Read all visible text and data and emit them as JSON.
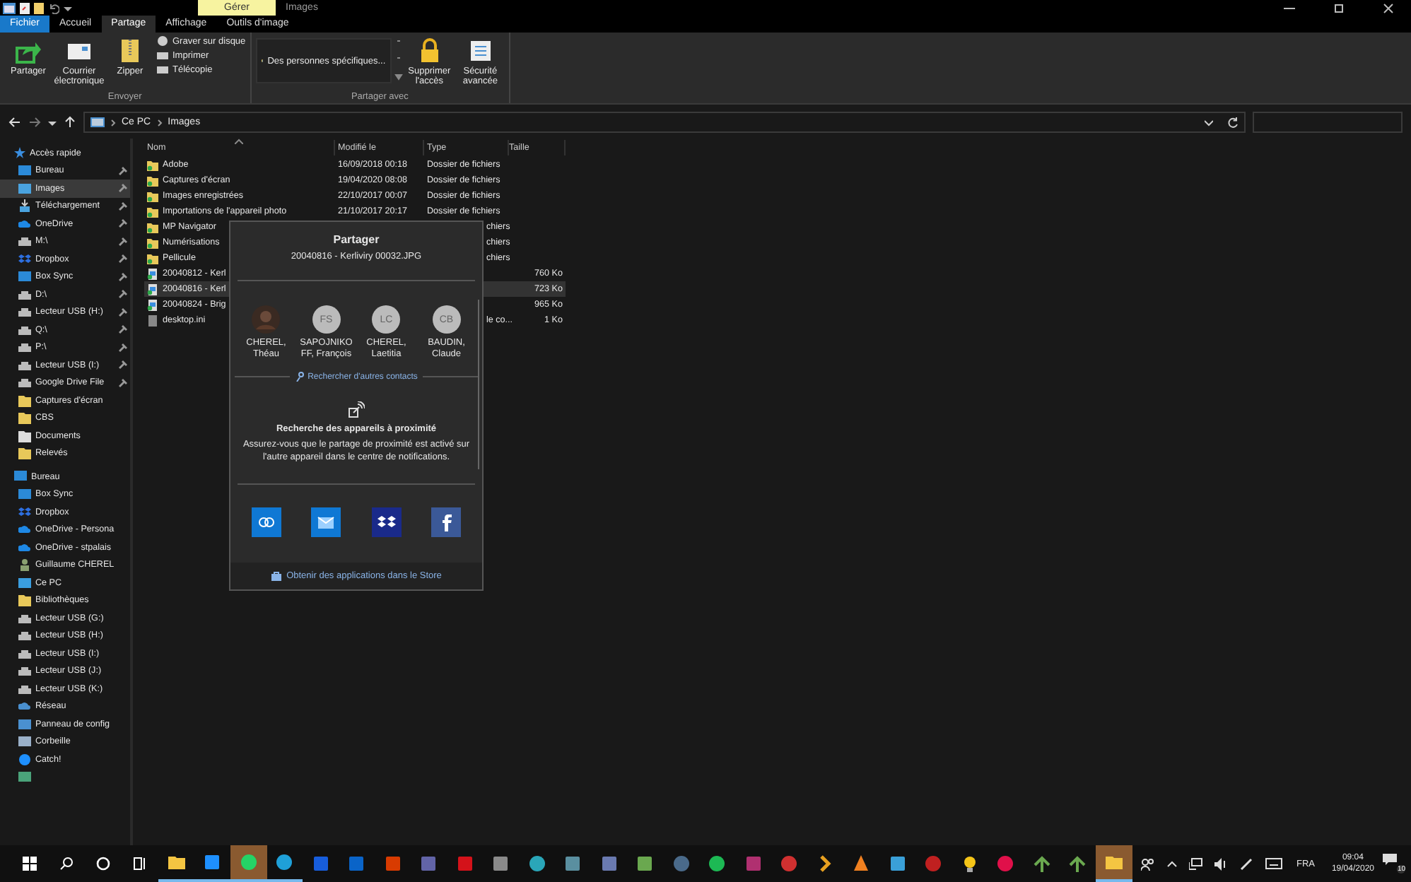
{
  "title_bar": {
    "context_tab": "Gérer",
    "title": "Images"
  },
  "ribbon_tabs": [
    {
      "label": "Fichier",
      "kind": "file",
      "selected": false
    },
    {
      "label": "Accueil",
      "kind": "tab",
      "selected": false
    },
    {
      "label": "Partage",
      "kind": "tab",
      "selected": true
    },
    {
      "label": "Affichage",
      "kind": "tab",
      "selected": false
    },
    {
      "label": "Outils d'image",
      "kind": "tab",
      "selected": false
    }
  ],
  "ribbon_groups": [
    {
      "label": "Envoyer",
      "large": [
        {
          "label": "Partager",
          "kind": "share"
        },
        {
          "label": "Courrier électronique",
          "kind": "mail"
        },
        {
          "label": "Zipper",
          "kind": "zip"
        }
      ],
      "small": [
        "Graver sur disque",
        "Imprimer",
        "Télécopie"
      ]
    },
    {
      "label": "Partager avec",
      "gallery": "Des personnes spécifiques...",
      "large": [
        {
          "label": "Supprimer l'accès",
          "kind": "lock"
        },
        {
          "label": "Sécurité avancée",
          "kind": "security"
        }
      ]
    }
  ],
  "address_bar": {
    "path": [
      "Ce PC",
      "Images"
    ]
  },
  "sidebar": {
    "sections": [
      {
        "label": "Accès rapide",
        "kind": "star",
        "items": [
          {
            "label": "Bureau",
            "kind": "tile",
            "color": "#2b8ad8",
            "pinned": true,
            "selected": false
          },
          {
            "label": "Images",
            "kind": "tile",
            "color": "#4aa3df",
            "pinned": true,
            "selected": true
          },
          {
            "label": "Téléchargement",
            "kind": "download",
            "color": "#4aa3df",
            "pinned": true,
            "selected": false
          },
          {
            "label": "OneDrive",
            "kind": "cloud",
            "color": "#1e88e5",
            "pinned": true,
            "selected": false
          },
          {
            "label": "M:\\",
            "kind": "drive",
            "color": "#bbbbbb",
            "pinned": true,
            "selected": false
          },
          {
            "label": "Dropbox",
            "kind": "dropbox",
            "color": "#2d6fe0",
            "pinned": true,
            "selected": false
          },
          {
            "label": "Box Sync",
            "kind": "tile",
            "color": "#2b8ad8",
            "pinned": true,
            "selected": false
          },
          {
            "label": "D:\\",
            "kind": "drive",
            "color": "#bbbbbb",
            "pinned": true,
            "selected": false
          },
          {
            "label": "Lecteur USB (H:)",
            "kind": "drive",
            "color": "#bbbbbb",
            "pinned": true,
            "selected": false
          },
          {
            "label": "Q:\\",
            "kind": "drive",
            "color": "#bbbbbb",
            "pinned": true,
            "selected": false
          },
          {
            "label": "P:\\",
            "kind": "drive",
            "color": "#bbbbbb",
            "pinned": true,
            "selected": false
          },
          {
            "label": "Lecteur USB (I:)",
            "kind": "drive",
            "color": "#bbbbbb",
            "pinned": true,
            "selected": false
          },
          {
            "label": "Google Drive File",
            "kind": "drive",
            "color": "#bbbbbb",
            "pinned": true,
            "selected": false
          },
          {
            "label": "Captures d'écran",
            "kind": "folder",
            "color": "#e8c85a",
            "pinned": false,
            "selected": false
          },
          {
            "label": "CBS",
            "kind": "folder",
            "color": "#e8c85a",
            "pinned": false,
            "selected": false
          },
          {
            "label": "Documents",
            "kind": "folder",
            "color": "#dddddd",
            "pinned": false,
            "selected": false
          },
          {
            "label": "Relevés",
            "kind": "folder",
            "color": "#e8c85a",
            "pinned": false,
            "selected": false
          }
        ]
      },
      {
        "label": "Bureau",
        "kind": "tile",
        "items": [
          {
            "label": "Box Sync",
            "kind": "tile",
            "color": "#2b8ad8",
            "selected": false
          },
          {
            "label": "Dropbox",
            "kind": "dropbox",
            "color": "#2d6fe0",
            "selected": false
          },
          {
            "label": "OneDrive - Persona",
            "kind": "cloud",
            "color": "#1e88e5",
            "selected": false
          },
          {
            "label": "OneDrive - stpalais",
            "kind": "cloud",
            "color": "#1e88e5",
            "selected": false
          },
          {
            "label": "Guillaume CHEREL",
            "kind": "person",
            "color": "#8aa070",
            "selected": false
          },
          {
            "label": "Ce PC",
            "kind": "tile",
            "color": "#3a9ee0",
            "selected": false
          },
          {
            "label": "Bibliothèques",
            "kind": "folder",
            "color": "#e8c85a",
            "selected": false
          },
          {
            "label": "Lecteur USB (G:)",
            "kind": "drive",
            "color": "#bbbbbb",
            "selected": false
          },
          {
            "label": "Lecteur USB (H:)",
            "kind": "drive",
            "color": "#bbbbbb",
            "selected": false
          },
          {
            "label": "Lecteur USB (I:)",
            "kind": "drive",
            "color": "#bbbbbb",
            "selected": false
          },
          {
            "label": "Lecteur USB (J:)",
            "kind": "drive",
            "color": "#bbbbbb",
            "selected": false
          },
          {
            "label": "Lecteur USB (K:)",
            "kind": "drive",
            "color": "#bbbbbb",
            "selected": false
          },
          {
            "label": "Réseau",
            "kind": "cloud",
            "color": "#4a90d0",
            "selected": false
          },
          {
            "label": "Panneau de config",
            "kind": "tile",
            "color": "#4a90d0",
            "selected": false
          },
          {
            "label": "Corbeille",
            "kind": "tile",
            "color": "#9ab0c8",
            "selected": false
          },
          {
            "label": "Catch!",
            "kind": "circle",
            "color": "#1e90ff",
            "selected": false
          },
          {
            "kind": "tile",
            "color": "#4aa37a",
            "selected": false
          }
        ]
      }
    ]
  },
  "file_list": {
    "columns": [
      "Nom",
      "Modifié le",
      "Type",
      "Taille"
    ],
    "rows": [
      {
        "kind": "folder",
        "name": "Adobe",
        "modified": "16/09/2018 00:18",
        "type": "Dossier de fichiers",
        "selected": false
      },
      {
        "kind": "folder",
        "name": "Captures d'écran",
        "modified": "19/04/2020 08:08",
        "type": "Dossier de fichiers",
        "selected": false
      },
      {
        "kind": "folder",
        "name": "Images enregistrées",
        "modified": "22/10/2017 00:07",
        "type": "Dossier de fichiers",
        "selected": false
      },
      {
        "kind": "folder",
        "name": "Importations de l'appareil photo",
        "modified": "21/10/2017 20:17",
        "type": "Dossier de fichiers",
        "selected": false
      },
      {
        "kind": "folder",
        "name": "MP Navigator",
        "type": "chiers",
        "selected": false
      },
      {
        "kind": "folder",
        "name": "Numérisations",
        "type": "chiers",
        "selected": false
      },
      {
        "kind": "folder",
        "name": "Pellicule",
        "type": "chiers",
        "selected": false
      },
      {
        "kind": "image",
        "name": "20040812 - Kerl",
        "size": "760 Ko",
        "selected": false
      },
      {
        "kind": "image",
        "name": "20040816 - Kerl",
        "size": "723 Ko",
        "selected": true
      },
      {
        "kind": "image",
        "name": "20040824 - Brig",
        "size": "965 Ko",
        "selected": false
      },
      {
        "kind": "file",
        "name": "desktop.ini",
        "type": "le co...",
        "size": "1 Ko",
        "selected": false
      }
    ]
  },
  "share_dialog": {
    "title": "Partager",
    "file": "20040816 - Kerliviry 00032.JPG",
    "contacts": [
      {
        "kind": "photo",
        "name": "CHEREL, Théau"
      },
      {
        "kind": "initials",
        "initials": "FS",
        "name": "SAPOJNIKO FF, François"
      },
      {
        "kind": "initials",
        "initials": "LC",
        "name": "CHEREL, Laetitia"
      },
      {
        "kind": "initials",
        "initials": "CB",
        "name": "BAUDIN, Claude"
      }
    ],
    "find_contacts": "Rechercher d'autres contacts",
    "nearby_title": "Recherche des appareils à proximité",
    "nearby_text": "Assurez-vous que le partage de proximité est activé sur l'autre appareil dans le centre de notifications.",
    "apps": [
      {
        "kind": "link",
        "color": "#0f78d4"
      },
      {
        "kind": "mail",
        "color": "#0f78d4"
      },
      {
        "kind": "dropbox",
        "color": "#1a2a8a"
      },
      {
        "kind": "facebook",
        "color": "#3b5998"
      }
    ],
    "store_link": "Obtenir des applications dans le Store"
  },
  "taskbar": {
    "apps": [
      {
        "kind": "folder",
        "color": "#f4c542",
        "running": true,
        "selected": false
      },
      {
        "kind": "tile",
        "color": "#1e90ff",
        "running": true,
        "selected": false
      },
      {
        "kind": "circle",
        "color": "#25d366",
        "running": true,
        "selected": true
      },
      {
        "kind": "circle",
        "color": "#1fa0d8",
        "running": true,
        "selected": false
      },
      {
        "kind": "tile",
        "color": "#175ddc",
        "running": false,
        "selected": false
      },
      {
        "kind": "tile",
        "color": "#0a64c8",
        "running": false,
        "selected": false
      },
      {
        "kind": "tile",
        "color": "#d83b01",
        "running": false,
        "selected": false
      },
      {
        "kind": "tile",
        "color": "#6264a7",
        "running": false,
        "selected": false
      },
      {
        "kind": "tile",
        "color": "#d4121a",
        "running": false,
        "selected": false
      },
      {
        "kind": "tile",
        "color": "#8a8a8a",
        "running": false,
        "selected": false
      },
      {
        "kind": "circle",
        "color": "#2aa6b8",
        "running": false,
        "selected": false
      },
      {
        "kind": "tile",
        "color": "#5a8fa0",
        "running": false,
        "selected": false
      },
      {
        "kind": "tile",
        "color": "#6a7ab0",
        "running": false,
        "selected": false
      },
      {
        "kind": "tile",
        "color": "#6aa84f",
        "running": false,
        "selected": false
      },
      {
        "kind": "circle",
        "color": "#4a6a8a",
        "running": false,
        "selected": false
      },
      {
        "kind": "circle",
        "color": "#1db954",
        "running": false,
        "selected": false
      },
      {
        "kind": "tile",
        "color": "#b03070",
        "running": false,
        "selected": false
      },
      {
        "kind": "circle",
        "color": "#d03030",
        "running": false,
        "selected": false
      },
      {
        "kind": "chevron",
        "color": "#e8a020",
        "running": false,
        "selected": false
      },
      {
        "kind": "cone",
        "color": "#f08020",
        "running": false,
        "selected": false
      },
      {
        "kind": "tile",
        "color": "#3aa0d8",
        "running": false,
        "selected": false
      },
      {
        "kind": "circle",
        "color": "#c02020",
        "running": false,
        "selected": false
      },
      {
        "kind": "bulb",
        "color": "#f5c518",
        "running": false,
        "selected": false
      },
      {
        "kind": "circle",
        "color": "#e0104a",
        "running": false,
        "selected": false
      },
      {
        "kind": "roof",
        "color": "#6aa84f",
        "running": false,
        "selected": false
      },
      {
        "kind": "roof",
        "color": "#6aa84f",
        "running": false,
        "selected": false
      },
      {
        "kind": "folder",
        "color": "#f4c542",
        "running": true,
        "selected": true
      }
    ],
    "language": "FRA",
    "time": "09:04",
    "date": "19/04/2020",
    "notifications": "10"
  }
}
